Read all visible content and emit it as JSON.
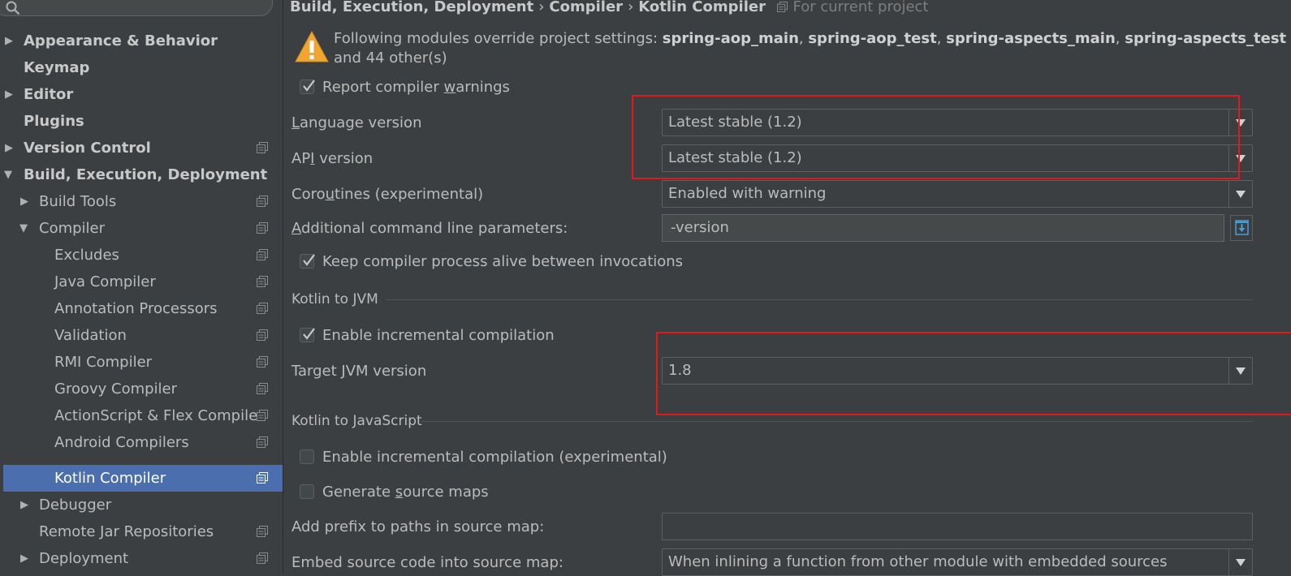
{
  "sidebar": {
    "items": [
      {
        "label": "Appearance & Behavior"
      },
      {
        "label": "Keymap"
      },
      {
        "label": "Editor"
      },
      {
        "label": "Plugins"
      },
      {
        "label": "Version Control"
      },
      {
        "label": "Build, Execution, Deployment"
      },
      {
        "label": "Build Tools"
      },
      {
        "label": "Compiler"
      },
      {
        "label": "Excludes"
      },
      {
        "label": "Java Compiler"
      },
      {
        "label": "Annotation Processors"
      },
      {
        "label": "Validation"
      },
      {
        "label": "RMI Compiler"
      },
      {
        "label": "Groovy Compiler"
      },
      {
        "label": "ActionScript & Flex Compile"
      },
      {
        "label": "Android Compilers"
      },
      {
        "label": "Kotlin Compiler"
      },
      {
        "label": "Debugger"
      },
      {
        "label": "Remote Jar Repositories"
      },
      {
        "label": "Deployment"
      }
    ]
  },
  "breadcrumb": {
    "parts": [
      "Build, Execution, Deployment",
      "Compiler",
      "Kotlin Compiler"
    ],
    "separator": "›",
    "scope": "For current project"
  },
  "warning": {
    "prefix": "Following modules override project settings: ",
    "modules": [
      "spring-aop_main",
      "spring-aop_test",
      "spring-aspects_main",
      "spring-aspects_test"
    ],
    "comma": ", ",
    "suffix": " and 44 other(s)"
  },
  "compiler": {
    "report_warnings": {
      "pre": "Report compiler ",
      "u": "w",
      "post": "arnings",
      "checked": true
    },
    "language_version": {
      "pre": "",
      "u": "L",
      "post": "anguage version",
      "value": "Latest stable (1.2)"
    },
    "api_version": {
      "pre": "AP",
      "u": "I",
      "post": " version",
      "value": "Latest stable (1.2)"
    },
    "coroutines": {
      "pre": "Coro",
      "u": "u",
      "post": "tines (experimental)",
      "value": "Enabled with warning"
    },
    "additional_params": {
      "pre": "",
      "u": "A",
      "post": "dditional command line parameters:",
      "value": "-version"
    },
    "keep_alive": {
      "label": "Keep compiler process alive between invocations",
      "checked": true
    }
  },
  "jvm": {
    "title": "Kotlin to JVM",
    "incremental": {
      "label": "Enable incremental compilation",
      "checked": true
    },
    "target": {
      "pre": "Target ",
      "u": "J",
      "post": "VM version",
      "value": "1.8"
    }
  },
  "js": {
    "title": "Kotlin to JavaScript",
    "incremental": {
      "label": "Enable incremental compilation (experimental)",
      "checked": false
    },
    "source_maps": {
      "pre": "Generate ",
      "u": "s",
      "post": "ource maps",
      "checked": false
    },
    "prefix_label": "Add prefix to paths in source map:",
    "prefix_value": "",
    "embed_label": "Embed source code into source map:",
    "embed_value": "When inlining a function from other module with embedded sources"
  },
  "colors": {
    "background": "#3c3f41",
    "selection": "#4b6eaf",
    "highlight_box": "#e0191b",
    "warning_icon": "#f0a732"
  }
}
